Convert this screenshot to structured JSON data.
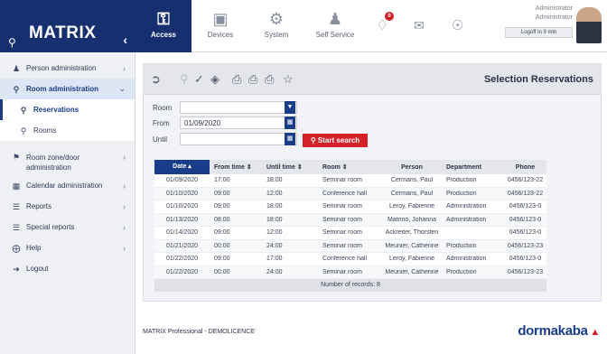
{
  "app": {
    "title": "MATRIX"
  },
  "sidebar": {
    "items": [
      {
        "label": "Person administration",
        "icon": "people-icon"
      },
      {
        "label": "Room administration",
        "icon": "room-search-icon"
      },
      {
        "label": "Reservations",
        "icon": "room-search-icon"
      },
      {
        "label": "Rooms",
        "icon": "room-search-icon"
      },
      {
        "label": "Room zone/door administration",
        "icon": "walking-person-icon"
      },
      {
        "label": "Calendar administration",
        "icon": "calendar-icon"
      },
      {
        "label": "Reports",
        "icon": "list-icon"
      },
      {
        "label": "Special reports",
        "icon": "list-icon"
      },
      {
        "label": "Help",
        "icon": "help-icon"
      },
      {
        "label": "Logout",
        "icon": "logout-icon"
      }
    ]
  },
  "topbar": {
    "modules": [
      {
        "label": "Access",
        "icon": "key-icon"
      },
      {
        "label": "Devices",
        "icon": "device-icon"
      },
      {
        "label": "System",
        "icon": "gear-icon"
      },
      {
        "label": "Self Service",
        "icon": "user-service-icon"
      }
    ],
    "notification_count": "0",
    "user_line1": "Administrator",
    "user_line2": "Administrator",
    "logoff": "Logoff in 9 min"
  },
  "panel": {
    "title": "Selection Reservations",
    "form": {
      "room_label": "Room",
      "room_value": "",
      "from_label": "From",
      "from_value": "01/09/2020",
      "until_label": "Until",
      "until_value": ""
    },
    "search_button": "Start search"
  },
  "table": {
    "headers": [
      "Date ▴",
      "From time ⇕",
      "Until time ⇕",
      "Room ⇕",
      "Person",
      "Department",
      "Phone"
    ],
    "rows": [
      [
        "01/09/2020",
        "17:00",
        "18:00",
        "Seminar room",
        "Cermans, Paul",
        "Production",
        "0456/123-22"
      ],
      [
        "01/10/2020",
        "09:00",
        "12:00",
        "Conference hall",
        "Cermans, Paul",
        "Production",
        "0456/123-22"
      ],
      [
        "01/10/2020",
        "09:00",
        "18:00",
        "Seminar room",
        "Leroy, Fabienne",
        "Administration",
        "0456/123-0"
      ],
      [
        "01/13/2020",
        "08:00",
        "18:00",
        "Seminar room",
        "Matrino, Johanna",
        "Administration",
        "0456/123-0"
      ],
      [
        "01/14/2020",
        "09:00",
        "12:00",
        "Seminar room",
        "Ackreiter, Thorsten",
        "",
        "0456/123-0"
      ],
      [
        "01/21/2020",
        "00:00",
        "24:00",
        "Seminar room",
        "Meunier, Catherine",
        "Production",
        "0456/123-23"
      ],
      [
        "01/22/2020",
        "09:00",
        "17:00",
        "Conference hall",
        "Leroy, Fabienne",
        "Administration",
        "0456/123-0"
      ],
      [
        "01/22/2020",
        "00:00",
        "24:00",
        "Seminar room",
        "Meunier, Catherine",
        "Production",
        "0456/123-23"
      ]
    ],
    "records": "Number of records: 8"
  },
  "footer": {
    "text": "MATRIX Professional - DEMOLICENCE",
    "brand": "dormakaba"
  },
  "colors": {
    "primary": "#16306f",
    "accent": "#d62027"
  }
}
